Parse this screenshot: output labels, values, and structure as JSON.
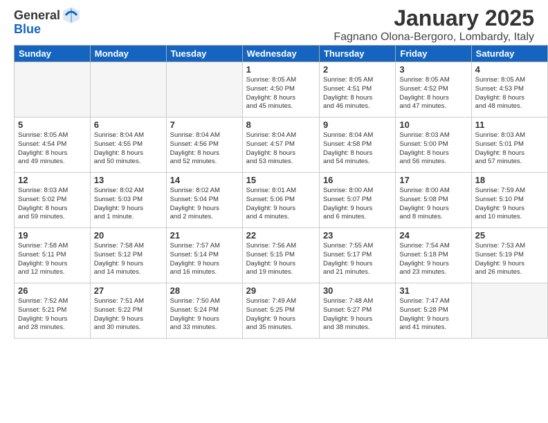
{
  "header": {
    "logo_general": "General",
    "logo_blue": "Blue",
    "month_title": "January 2025",
    "location": "Fagnano Olona-Bergoro, Lombardy, Italy"
  },
  "days_of_week": [
    "Sunday",
    "Monday",
    "Tuesday",
    "Wednesday",
    "Thursday",
    "Friday",
    "Saturday"
  ],
  "weeks": [
    [
      {
        "day": "",
        "info": ""
      },
      {
        "day": "",
        "info": ""
      },
      {
        "day": "",
        "info": ""
      },
      {
        "day": "1",
        "info": "Sunrise: 8:05 AM\nSunset: 4:50 PM\nDaylight: 8 hours\nand 45 minutes."
      },
      {
        "day": "2",
        "info": "Sunrise: 8:05 AM\nSunset: 4:51 PM\nDaylight: 8 hours\nand 46 minutes."
      },
      {
        "day": "3",
        "info": "Sunrise: 8:05 AM\nSunset: 4:52 PM\nDaylight: 8 hours\nand 47 minutes."
      },
      {
        "day": "4",
        "info": "Sunrise: 8:05 AM\nSunset: 4:53 PM\nDaylight: 8 hours\nand 48 minutes."
      }
    ],
    [
      {
        "day": "5",
        "info": "Sunrise: 8:05 AM\nSunset: 4:54 PM\nDaylight: 8 hours\nand 49 minutes."
      },
      {
        "day": "6",
        "info": "Sunrise: 8:04 AM\nSunset: 4:55 PM\nDaylight: 8 hours\nand 50 minutes."
      },
      {
        "day": "7",
        "info": "Sunrise: 8:04 AM\nSunset: 4:56 PM\nDaylight: 8 hours\nand 52 minutes."
      },
      {
        "day": "8",
        "info": "Sunrise: 8:04 AM\nSunset: 4:57 PM\nDaylight: 8 hours\nand 53 minutes."
      },
      {
        "day": "9",
        "info": "Sunrise: 8:04 AM\nSunset: 4:58 PM\nDaylight: 8 hours\nand 54 minutes."
      },
      {
        "day": "10",
        "info": "Sunrise: 8:03 AM\nSunset: 5:00 PM\nDaylight: 8 hours\nand 56 minutes."
      },
      {
        "day": "11",
        "info": "Sunrise: 8:03 AM\nSunset: 5:01 PM\nDaylight: 8 hours\nand 57 minutes."
      }
    ],
    [
      {
        "day": "12",
        "info": "Sunrise: 8:03 AM\nSunset: 5:02 PM\nDaylight: 8 hours\nand 59 minutes."
      },
      {
        "day": "13",
        "info": "Sunrise: 8:02 AM\nSunset: 5:03 PM\nDaylight: 9 hours\nand 1 minute."
      },
      {
        "day": "14",
        "info": "Sunrise: 8:02 AM\nSunset: 5:04 PM\nDaylight: 9 hours\nand 2 minutes."
      },
      {
        "day": "15",
        "info": "Sunrise: 8:01 AM\nSunset: 5:06 PM\nDaylight: 9 hours\nand 4 minutes."
      },
      {
        "day": "16",
        "info": "Sunrise: 8:00 AM\nSunset: 5:07 PM\nDaylight: 9 hours\nand 6 minutes."
      },
      {
        "day": "17",
        "info": "Sunrise: 8:00 AM\nSunset: 5:08 PM\nDaylight: 9 hours\nand 8 minutes."
      },
      {
        "day": "18",
        "info": "Sunrise: 7:59 AM\nSunset: 5:10 PM\nDaylight: 9 hours\nand 10 minutes."
      }
    ],
    [
      {
        "day": "19",
        "info": "Sunrise: 7:58 AM\nSunset: 5:11 PM\nDaylight: 9 hours\nand 12 minutes."
      },
      {
        "day": "20",
        "info": "Sunrise: 7:58 AM\nSunset: 5:12 PM\nDaylight: 9 hours\nand 14 minutes."
      },
      {
        "day": "21",
        "info": "Sunrise: 7:57 AM\nSunset: 5:14 PM\nDaylight: 9 hours\nand 16 minutes."
      },
      {
        "day": "22",
        "info": "Sunrise: 7:56 AM\nSunset: 5:15 PM\nDaylight: 9 hours\nand 19 minutes."
      },
      {
        "day": "23",
        "info": "Sunrise: 7:55 AM\nSunset: 5:17 PM\nDaylight: 9 hours\nand 21 minutes."
      },
      {
        "day": "24",
        "info": "Sunrise: 7:54 AM\nSunset: 5:18 PM\nDaylight: 9 hours\nand 23 minutes."
      },
      {
        "day": "25",
        "info": "Sunrise: 7:53 AM\nSunset: 5:19 PM\nDaylight: 9 hours\nand 26 minutes."
      }
    ],
    [
      {
        "day": "26",
        "info": "Sunrise: 7:52 AM\nSunset: 5:21 PM\nDaylight: 9 hours\nand 28 minutes."
      },
      {
        "day": "27",
        "info": "Sunrise: 7:51 AM\nSunset: 5:22 PM\nDaylight: 9 hours\nand 30 minutes."
      },
      {
        "day": "28",
        "info": "Sunrise: 7:50 AM\nSunset: 5:24 PM\nDaylight: 9 hours\nand 33 minutes."
      },
      {
        "day": "29",
        "info": "Sunrise: 7:49 AM\nSunset: 5:25 PM\nDaylight: 9 hours\nand 35 minutes."
      },
      {
        "day": "30",
        "info": "Sunrise: 7:48 AM\nSunset: 5:27 PM\nDaylight: 9 hours\nand 38 minutes."
      },
      {
        "day": "31",
        "info": "Sunrise: 7:47 AM\nSunset: 5:28 PM\nDaylight: 9 hours\nand 41 minutes."
      },
      {
        "day": "",
        "info": ""
      }
    ]
  ]
}
